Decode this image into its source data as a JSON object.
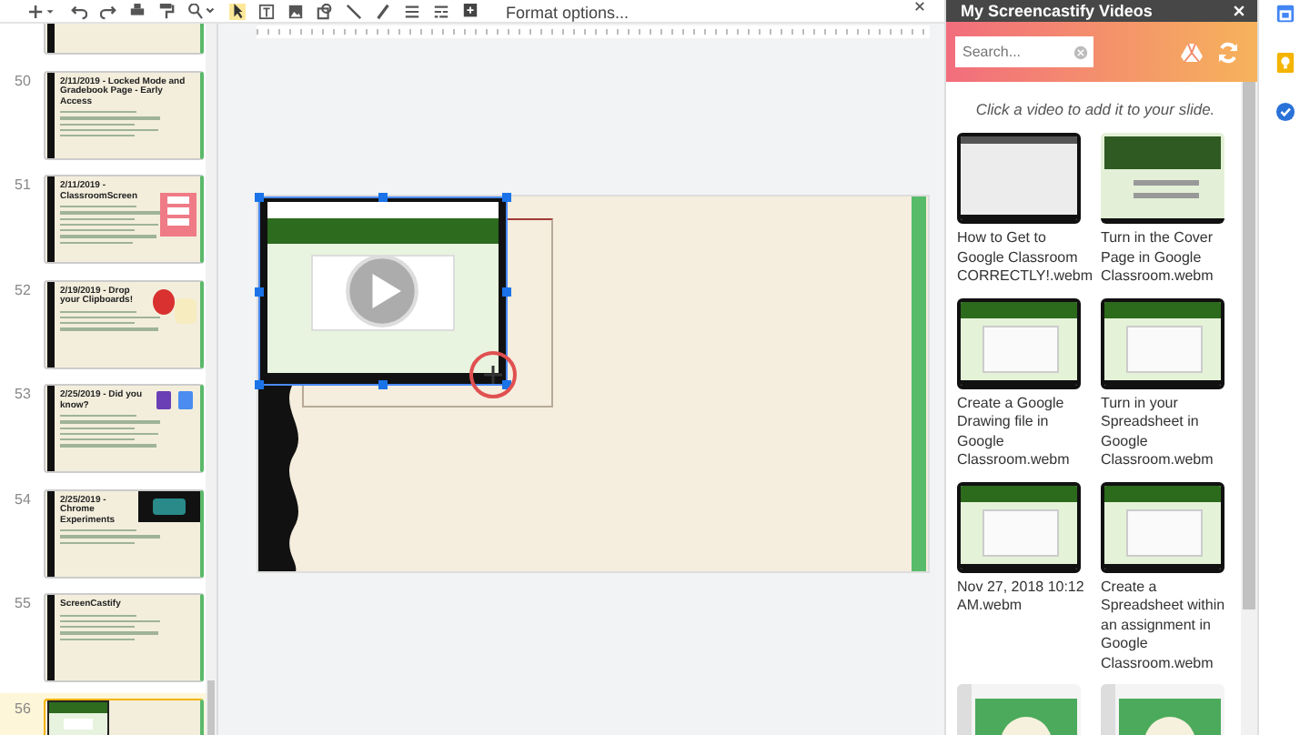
{
  "toolbar": {
    "format_options": "Format options..."
  },
  "filmstrip": {
    "slides": [
      {
        "selected": false,
        "kind": "plain"
      },
      {
        "number": "50",
        "title": "2/11/2019 - Locked Mode and Gradebook Page - Early Access",
        "kind": "plain",
        "selected": false
      },
      {
        "number": "51",
        "title": "2/11/2019 - ClassroomScreen",
        "kind": "sign",
        "selected": false
      },
      {
        "number": "52",
        "title": "2/19/2019 - Drop your Clipboards!",
        "kind": "cartoon",
        "selected": false
      },
      {
        "number": "53",
        "title": "2/25/2019 - Did you know?",
        "kind": "app-icons",
        "selected": false
      },
      {
        "number": "54",
        "title": "2/25/2019 - Chrome Experiments",
        "kind": "video",
        "selected": false
      },
      {
        "number": "55",
        "title": "ScreenCastify",
        "kind": "plain",
        "selected": false
      },
      {
        "number": "56",
        "kind": "screenshot",
        "selected": true
      }
    ]
  },
  "panel": {
    "title": "My Screencastify Videos",
    "search": {
      "placeholder": "Search..."
    },
    "hint": "Click a video to add it to your slide.",
    "videos": [
      {
        "title": "How to Get to Google Classroom CORRECTLY!.webm",
        "kind": "blank"
      },
      {
        "title": "Turn in the Cover Page in Google Classroom.webm",
        "kind": "leaf"
      },
      {
        "title": "Create a Google Drawing file in Google Classroom.webm",
        "kind": "form"
      },
      {
        "title": "Turn in your Spreadsheet in Google Classroom.webm",
        "kind": "form"
      },
      {
        "title": "Nov 27, 2018 10:12 AM.webm",
        "kind": "form"
      },
      {
        "title": "Create a Spreadsheet within an assignment in Google Classroom.webm",
        "kind": "form"
      },
      {
        "kind": "tips"
      },
      {
        "kind": "tips"
      }
    ]
  }
}
